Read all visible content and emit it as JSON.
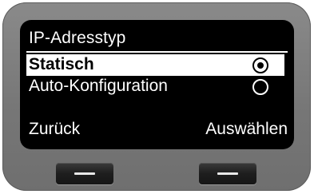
{
  "screen": {
    "title": "IP-Adresstyp",
    "options": [
      {
        "label": "Statisch",
        "selected": true
      },
      {
        "label": "Auto-Konfiguration",
        "selected": false
      }
    ]
  },
  "softkeys": {
    "left_label": "Zurück",
    "right_label": "Auswählen"
  },
  "colors": {
    "screen_background": "#000000",
    "screen_text": "#ffffff",
    "highlight_background": "#ffffff",
    "highlight_text": "#000000",
    "device_body": "#7a7a7a"
  },
  "icons": {
    "selected_radio": "radio-selected-icon",
    "unselected_radio": "radio-unselected-icon",
    "softkey_bar": "minus-bar-icon"
  }
}
